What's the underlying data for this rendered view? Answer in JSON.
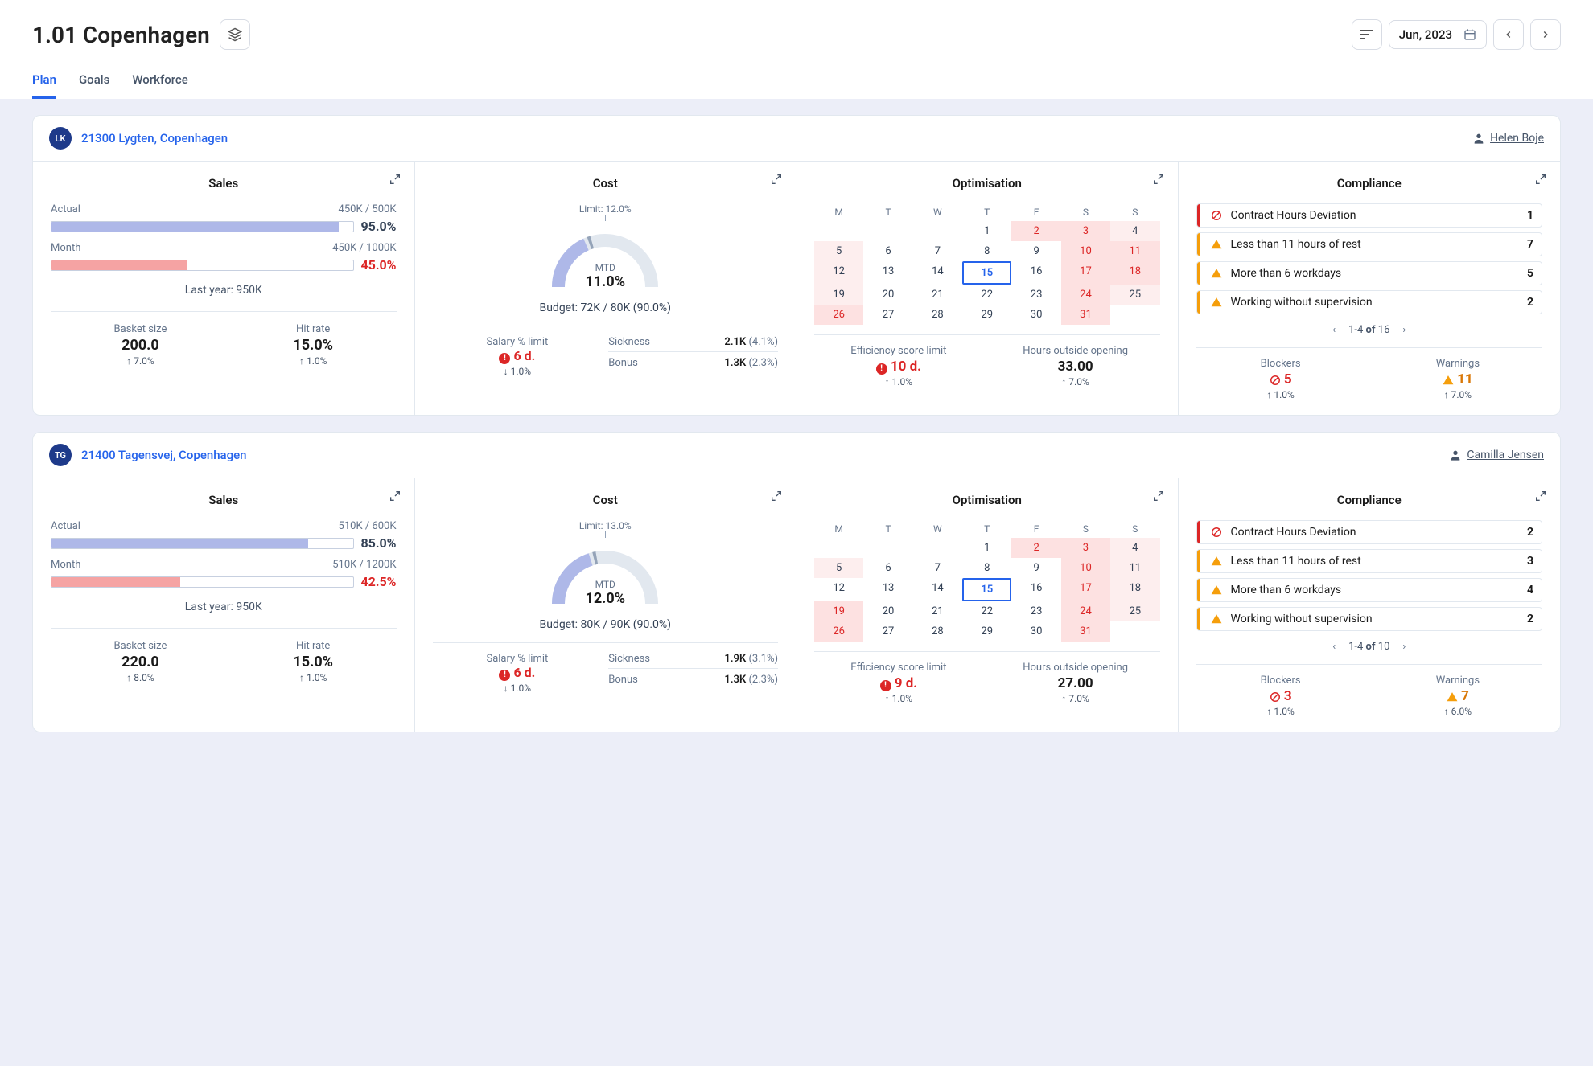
{
  "header": {
    "title": "1.01 Copenhagen",
    "date": "Jun, 2023",
    "tabs": [
      "Plan",
      "Goals",
      "Workforce"
    ],
    "active_tab": 0
  },
  "cal_head": [
    "M",
    "T",
    "W",
    "T",
    "F",
    "S",
    "S"
  ],
  "stores": [
    {
      "avatar": "LK",
      "name": "21300 Lygten, Copenhagen",
      "manager": "Helen Boje",
      "sales": {
        "title": "Sales",
        "actual_label": "Actual",
        "actual_range": "450K / 500K",
        "actual_pct": "95.0%",
        "actual_fill": 95,
        "month_label": "Month",
        "month_range": "450K / 1000K",
        "month_pct": "45.0%",
        "month_fill": 45,
        "last_year": "Last year: 950K",
        "basket": {
          "label": "Basket size",
          "value": "200.0",
          "delta": "↑ 7.0%"
        },
        "hit": {
          "label": "Hit rate",
          "value": "15.0%",
          "delta": "↑ 1.0%"
        }
      },
      "cost": {
        "title": "Cost",
        "limit": "Limit: 12.0%",
        "mtd_label": "MTD",
        "mtd_value": "11.0%",
        "gauge_val": 11.0,
        "gauge_limit": 12.0,
        "budget": "Budget: 72K / 80K (90.0%)",
        "salary": {
          "label": "Salary % limit",
          "days": "6 d.",
          "delta": "↓ 1.0%"
        },
        "sickness": {
          "k": "Sickness",
          "v": "2.1K",
          "sub": "(4.1%)"
        },
        "bonus": {
          "k": "Bonus",
          "v": "1.3K",
          "sub": "(2.3%)"
        }
      },
      "opt": {
        "title": "Optimisation",
        "month_start_dow": 3,
        "days": 31,
        "today": 15,
        "red_days": [
          2,
          3,
          10,
          11,
          17,
          18,
          24,
          26,
          31
        ],
        "pink_days": [
          4,
          5,
          12,
          19,
          25
        ],
        "eff": {
          "label": "Efficiency score limit",
          "val": "10 d.",
          "delta": "↑ 1.0%"
        },
        "hours": {
          "label": "Hours outside opening",
          "val": "33.00",
          "delta": "↑ 7.0%"
        }
      },
      "comp": {
        "title": "Compliance",
        "items": [
          {
            "type": "block",
            "text": "Contract Hours Deviation",
            "count": "1"
          },
          {
            "type": "warn",
            "text": "Less than 11 hours of rest",
            "count": "7"
          },
          {
            "type": "warn",
            "text": "More than 6 workdays",
            "count": "5"
          },
          {
            "type": "warn",
            "text": "Working without supervision",
            "count": "2"
          }
        ],
        "pagination": "1-4 of 16",
        "blockers": {
          "label": "Blockers",
          "val": "5",
          "delta": "↑ 1.0%"
        },
        "warnings": {
          "label": "Warnings",
          "val": "11",
          "delta": "↑ 7.0%"
        }
      }
    },
    {
      "avatar": "TG",
      "name": "21400 Tagensvej, Copenhagen",
      "manager": "Camilla Jensen",
      "sales": {
        "title": "Sales",
        "actual_label": "Actual",
        "actual_range": "510K / 600K",
        "actual_pct": "85.0%",
        "actual_fill": 85,
        "month_label": "Month",
        "month_range": "510K / 1200K",
        "month_pct": "42.5%",
        "month_fill": 42.5,
        "last_year": "Last year: 950K",
        "basket": {
          "label": "Basket size",
          "value": "220.0",
          "delta": "↑ 8.0%"
        },
        "hit": {
          "label": "Hit rate",
          "value": "15.0%",
          "delta": "↑ 1.0%"
        }
      },
      "cost": {
        "title": "Cost",
        "limit": "Limit: 13.0%",
        "mtd_label": "MTD",
        "mtd_value": "12.0%",
        "gauge_val": 12.0,
        "gauge_limit": 13.0,
        "budget": "Budget: 80K / 90K (90.0%)",
        "salary": {
          "label": "Salary % limit",
          "days": "6 d.",
          "delta": "↓ 1.0%"
        },
        "sickness": {
          "k": "Sickness",
          "v": "1.9K",
          "sub": "(3.1%)"
        },
        "bonus": {
          "k": "Bonus",
          "v": "1.3K",
          "sub": "(2.3%)"
        }
      },
      "opt": {
        "title": "Optimisation",
        "month_start_dow": 3,
        "days": 31,
        "today": 15,
        "red_days": [
          2,
          3,
          10,
          17,
          19,
          24,
          26,
          31
        ],
        "pink_days": [
          4,
          5,
          11,
          18,
          25
        ],
        "eff": {
          "label": "Efficiency score limit",
          "val": "9 d.",
          "delta": "↑ 1.0%"
        },
        "hours": {
          "label": "Hours outside opening",
          "val": "27.00",
          "delta": "↑ 7.0%"
        }
      },
      "comp": {
        "title": "Compliance",
        "items": [
          {
            "type": "block",
            "text": "Contract Hours Deviation",
            "count": "2"
          },
          {
            "type": "warn",
            "text": "Less than 11 hours of rest",
            "count": "3"
          },
          {
            "type": "warn",
            "text": "More than 6 workdays",
            "count": "4"
          },
          {
            "type": "warn",
            "text": "Working without supervision",
            "count": "2"
          }
        ],
        "pagination": "1-4 of 10",
        "blockers": {
          "label": "Blockers",
          "val": "3",
          "delta": "↑ 1.0%"
        },
        "warnings": {
          "label": "Warnings",
          "val": "7",
          "delta": "↑ 6.0%"
        }
      }
    }
  ]
}
